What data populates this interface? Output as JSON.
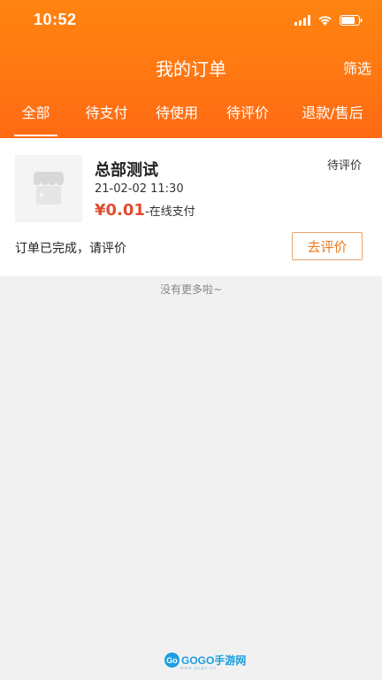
{
  "status_bar": {
    "time": "10:52",
    "icons": [
      "cellular-signal-icon",
      "wifi-icon",
      "battery-icon"
    ]
  },
  "nav": {
    "title": "我的订单",
    "filter_label": "筛选"
  },
  "tabs": [
    {
      "label": "全部",
      "selected": true
    },
    {
      "label": "待支付",
      "selected": false
    },
    {
      "label": "待使用",
      "selected": false
    },
    {
      "label": "待评价",
      "selected": false
    },
    {
      "label": "退款/售后",
      "selected": false
    }
  ],
  "order": {
    "thumbnail_icon": "store-icon",
    "store_name": "总部测试",
    "status": "待评价",
    "date": "21-02-02 11:30",
    "price": "¥0.01",
    "payment_method": "-在线支付",
    "completion_text": "订单已完成，请评价",
    "review_button_label": "去评价"
  },
  "list_footer": "没有更多啦~",
  "watermark": {
    "badge": "Go",
    "text": "GOGO手游网",
    "sub": "www.gogo.cn"
  },
  "colors": {
    "header_orange": "#ff7a12",
    "price_red": "#e24b30",
    "button_orange": "#ec7a1e",
    "page_background": "#f1f1f1"
  }
}
